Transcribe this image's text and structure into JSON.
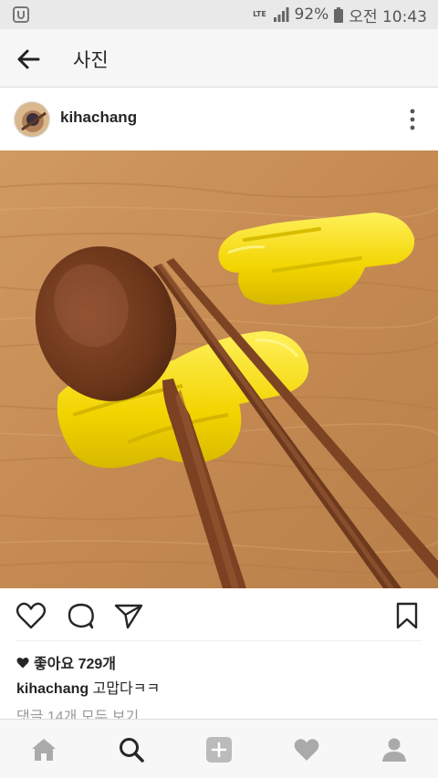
{
  "status_bar": {
    "network": "LTE",
    "battery": "92%",
    "time": "오전 10:43"
  },
  "header": {
    "title": "사진",
    "back_icon": "arrow-left-icon"
  },
  "post": {
    "username": "kihachang",
    "likes": "좋아요 729개",
    "caption_user": "kihachang",
    "caption_text": "고맙다ㅋㅋ",
    "comments_link": "댓글 14개 모두 보기"
  },
  "nav": [
    "home-icon",
    "search-icon",
    "add-icon",
    "heart-icon",
    "profile-icon"
  ],
  "colors": {
    "wood": "#c98d55",
    "yellow": "#f2d800",
    "text": "#262626",
    "muted": "#999999"
  }
}
